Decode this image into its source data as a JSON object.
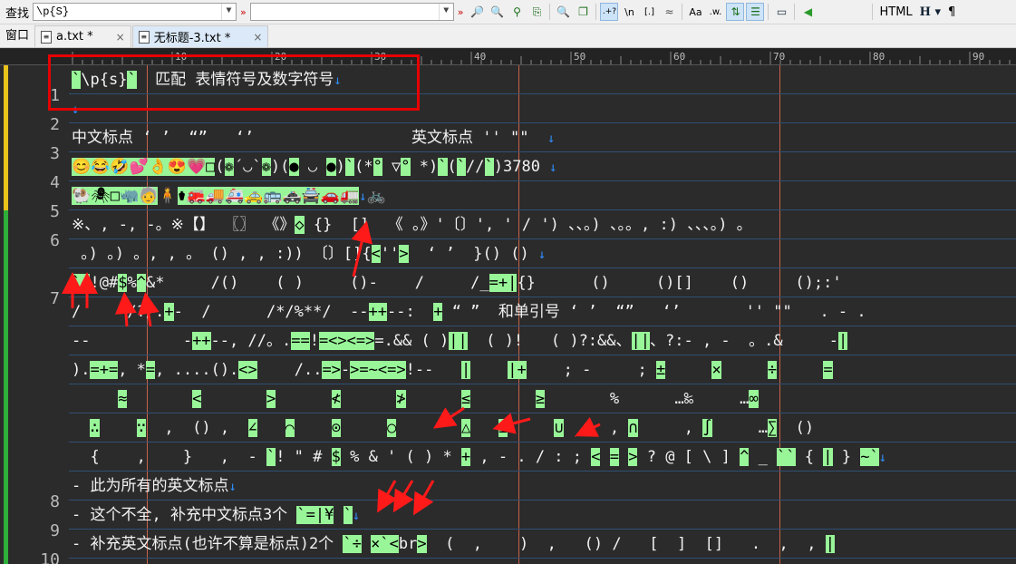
{
  "toolbar": {
    "find_label": "查找",
    "find_value": "\\p{S}",
    "replace_value": "",
    "icons": [
      "find-next-icon",
      "find-prev-icon",
      "find-all-icon",
      "replace-icon",
      "zoom-icon",
      "copy-icon",
      "regex-icon",
      "newline-icon",
      "bracket-icon",
      "fuzzy-icon",
      "case-icon",
      "word-icon",
      "wrap-icon",
      "sel-icon",
      "view-icon",
      "back-icon"
    ],
    "regex_label": ".+?",
    "newline_label": "\\n",
    "bracket_label": "[.]",
    "fuzzy_label": "≈",
    "case_label": "Aa",
    "word_label": ".w.",
    "html_label": "HTML",
    "h_label": "H",
    "para_label": "¶"
  },
  "tabs": {
    "window_label": "窗口",
    "items": [
      {
        "name": "a.txt *",
        "active": false
      },
      {
        "name": "无标题-3.txt *",
        "active": true
      }
    ],
    "close_glyph": "×"
  },
  "ruler": {
    "labels": [
      "10",
      "20",
      "30",
      "40",
      "50",
      "60",
      "70",
      "80",
      "90"
    ]
  },
  "lines": [
    {
      "num": "1",
      "html": "<span class='hl'>`</span>\\p{s}<span class='hl'>`</span>  匹配 表情符号及数字符号<span class='eol'>↓</span>"
    },
    {
      "num": "2",
      "html": "<span class='eol'>↓</span>"
    },
    {
      "num": "3",
      "html": "中文标点 ‘ ’  “”   ‘’                 英文标点 '' \"\"  <span class='eol'>↓</span>"
    },
    {
      "num": "4",
      "html": "<span class='hl'>😊😂🤣💕👌😍💗□</span>(<span class='hl'>❁</span>´◡`<span class='hl'>❁</span>)(<span class='hl'>●</span> ◡ <span class='hl'>●</span>)<span class='hl'>`</span>(*<span class='hl'>°</span> ▽<span class='hl'>°</span> *)<span class='hl'>`</span>(<span class='hl'>`</span>//<span class='hl'>`</span>)3780 <span class='eol'>↓</span>"
    },
    {
      "num": "5",
      "html": "<span class='hl'>🐏🕷□🦏🧓</span>🧍<span class='hl'>⚱🚒🚚🚑🚕🚌🚓🚔🚗🚛</span><span class='eol'>↓</span>🚲"
    },
    {
      "num": "6",
      "html": "※、, -, -。※【】 〖〗 《》<span class='hl'>◇</span> {}  []  《 。》'〔〕', ' / ') 、、。) 、。。, :) 、、、。) 。"
    },
    {
      "num": "",
      "html": " 。) 。) 。, , 。 () , , :)) 〔〕[]{<span class='hl'><</span>''<span class='hl'>></span>  ‘ ’  }() () <span class='eol'>↓</span>"
    },
    {
      "num": "7",
      "html": "<span class='hl'>`~</span>!@#<span class='hl'>$</span>%<span class='hl'>^</span>&*     /()    ( )     ()-    /     /_<span class='hl'>=+</span><span class='hl'>|</span>{}      ()     ()[]    ()     ();:'"
    },
    {
      "num": "",
      "html": "/     /?/.<span class='hl'>+</span>-  /      /*/%**/  --<span class='hl'>++</span>--:  <span class='hl'>+</span> “ ”  和单引号 ‘ ’  “”   ‘’       '' \"\"   . - ."
    },
    {
      "num": "",
      "html": "--          -<span class='hl'>++</span>--, //。.<span class='hl'>==</span>!<span class='hl'>=<></span><span class='hl'><=></span>=.&& ( )<span class='hl'>||</span>  ( )!   ( )?:&&、<span class='hl'>||</span>、?:- , -  。.&     -<span class='hl'>|</span>"
    },
    {
      "num": "",
      "html": ").<span class='hl'>=+=</span>, *<span class='hl'>=</span>, ....().<span class='hl'><></span>    /..<span class='hl'>=></span>-<span class='hl'>>=</span><span class='hl'>~<=></span>!--   <span class='hl'>|</span>    <span class='hl'>|+</span>    ; -     ; <span class='hl'>±</span>     <span class='hl'>×</span>     <span class='hl'>÷</span>     <span class='hl'>=</span>"
    },
    {
      "num": "",
      "html": "     <span class='hl'>≈</span>       <span class='hl'><</span>       <span class='hl'>></span>      <span class='hl'>≮</span>      <span class='hl'>≯</span>      <span class='hl'>≤</span>       <span class='hl'>≥</span>       %      …‰     …<span class='hl'>∞</span>"
    },
    {
      "num": "",
      "html": "  <span class='hl'>∴</span>    <span class='hl'>∵</span>  ,  () ,  <span class='hl'>∠</span>   <span class='hl'>⌒</span>    <span class='hl'>⊙</span>     <span class='hl'>○</span>       <span class='hl'>△</span>   <span class='hl'>⊥</span>     <span class='hl'>∪</span>     , <span class='hl'>∩</span>     , <span class='hl'>∫</span>     …<span class='hl'>∑</span>  ()"
    },
    {
      "num": "",
      "html": "  {    ,    }   ,  - <span class='hl'>`</span>! \" # <span class='hl'>$</span> % & ' ( ) * <span class='hl'>+</span> , - . / : ; <span class='hl'><</span> <span class='hl'>=</span> <span class='hl'>></span> ? @ [ \\ ] <span class='hl'>^</span> _ <span class='hl'>``</span> { <span class='hl'>|</span> } <span class='hl'>~`</span><span class='eol'>↓</span>"
    },
    {
      "num": "8",
      "html": "- 此为所有的英文标点<span class='eol'>↓</span>"
    },
    {
      "num": "9",
      "html": "- 这个不全, 补充中文标点3个 <span class='hl'>`=|¥</span> <span class='hl'>`</span><span class='eol'>↓</span>"
    },
    {
      "num": "10",
      "html": "- 补充英文标点(也许不算是标点)2个 <span class='hl'>`÷</span> <span class='hl'>×`</span><span class='hl'><</span>br<span class='hl'>></span>  (  ,    )  ,   () /   [  ]  []   .  ,  , <span class='hl'>|</span>"
    }
  ]
}
